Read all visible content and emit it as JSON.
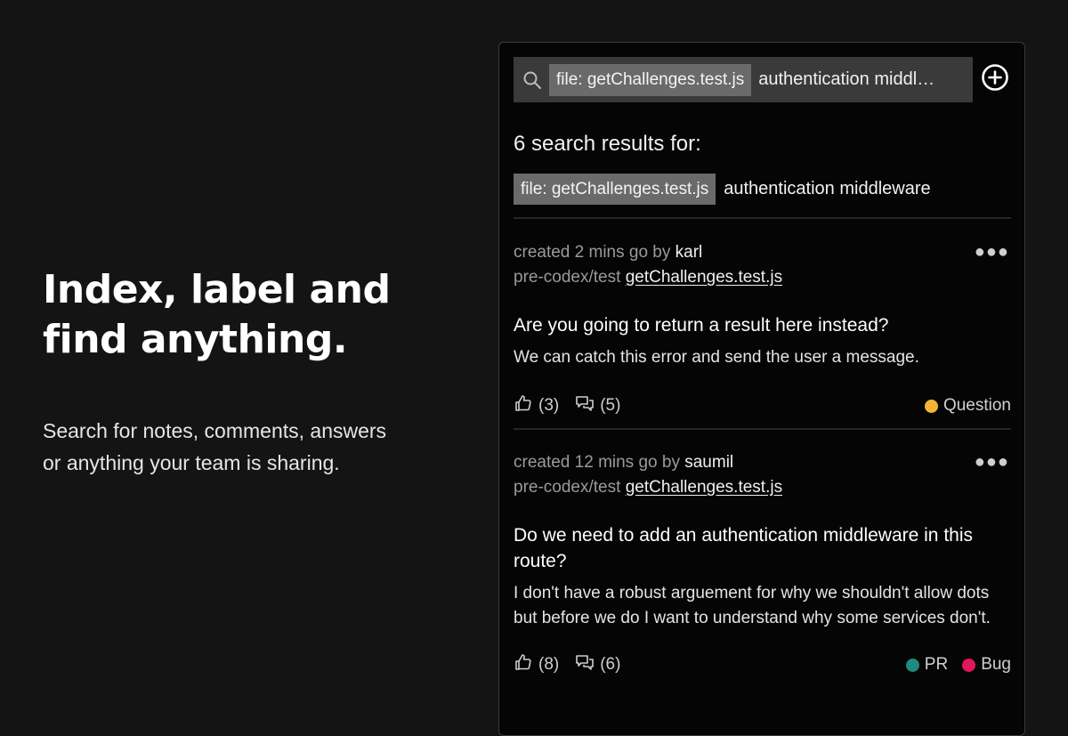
{
  "hero": {
    "headline_line1": "Index, label and",
    "headline_line2": "find anything.",
    "subtitle_line1": "Search for notes, comments, answers",
    "subtitle_line2": "or anything your team is sharing."
  },
  "search": {
    "chip_label": "file:",
    "chip_value": "getChallenges.test.js",
    "query_text": "authentication middleware"
  },
  "results_header": {
    "title": "6 search results for:",
    "chip_label": "file:",
    "chip_value": "getChallenges.test.js",
    "query_text": "authentication middleware"
  },
  "results": [
    {
      "created_prefix": "created 2 mins go by",
      "author": "karl",
      "path": "pre-codex/test",
      "file": "getChallenges.test.js",
      "title": "Are you going to return a result here instead?",
      "body": "We can catch this error and send the user a message.",
      "likes": "(3)",
      "comments": "(5)",
      "tags": [
        {
          "label": "Question",
          "color": "#f5b335"
        }
      ]
    },
    {
      "created_prefix": "created 12 mins go by",
      "author": "saumil",
      "path": "pre-codex/test",
      "file": "getChallenges.test.js",
      "title": "Do we need to add an authentication middleware in this route?",
      "body": "I don't have a robust arguement for why we shouldn't allow dots but before we do I want to understand why some services don't.",
      "likes": "(8)",
      "comments": "(6)",
      "tags": [
        {
          "label": "PR",
          "color": "#1f8a80"
        },
        {
          "label": "Bug",
          "color": "#e0185e"
        }
      ]
    }
  ],
  "icons": {
    "search": "search-icon",
    "add": "plus-circle-icon",
    "more": "more-dots-icon",
    "like": "thumbs-up-icon",
    "comment": "comments-icon"
  }
}
